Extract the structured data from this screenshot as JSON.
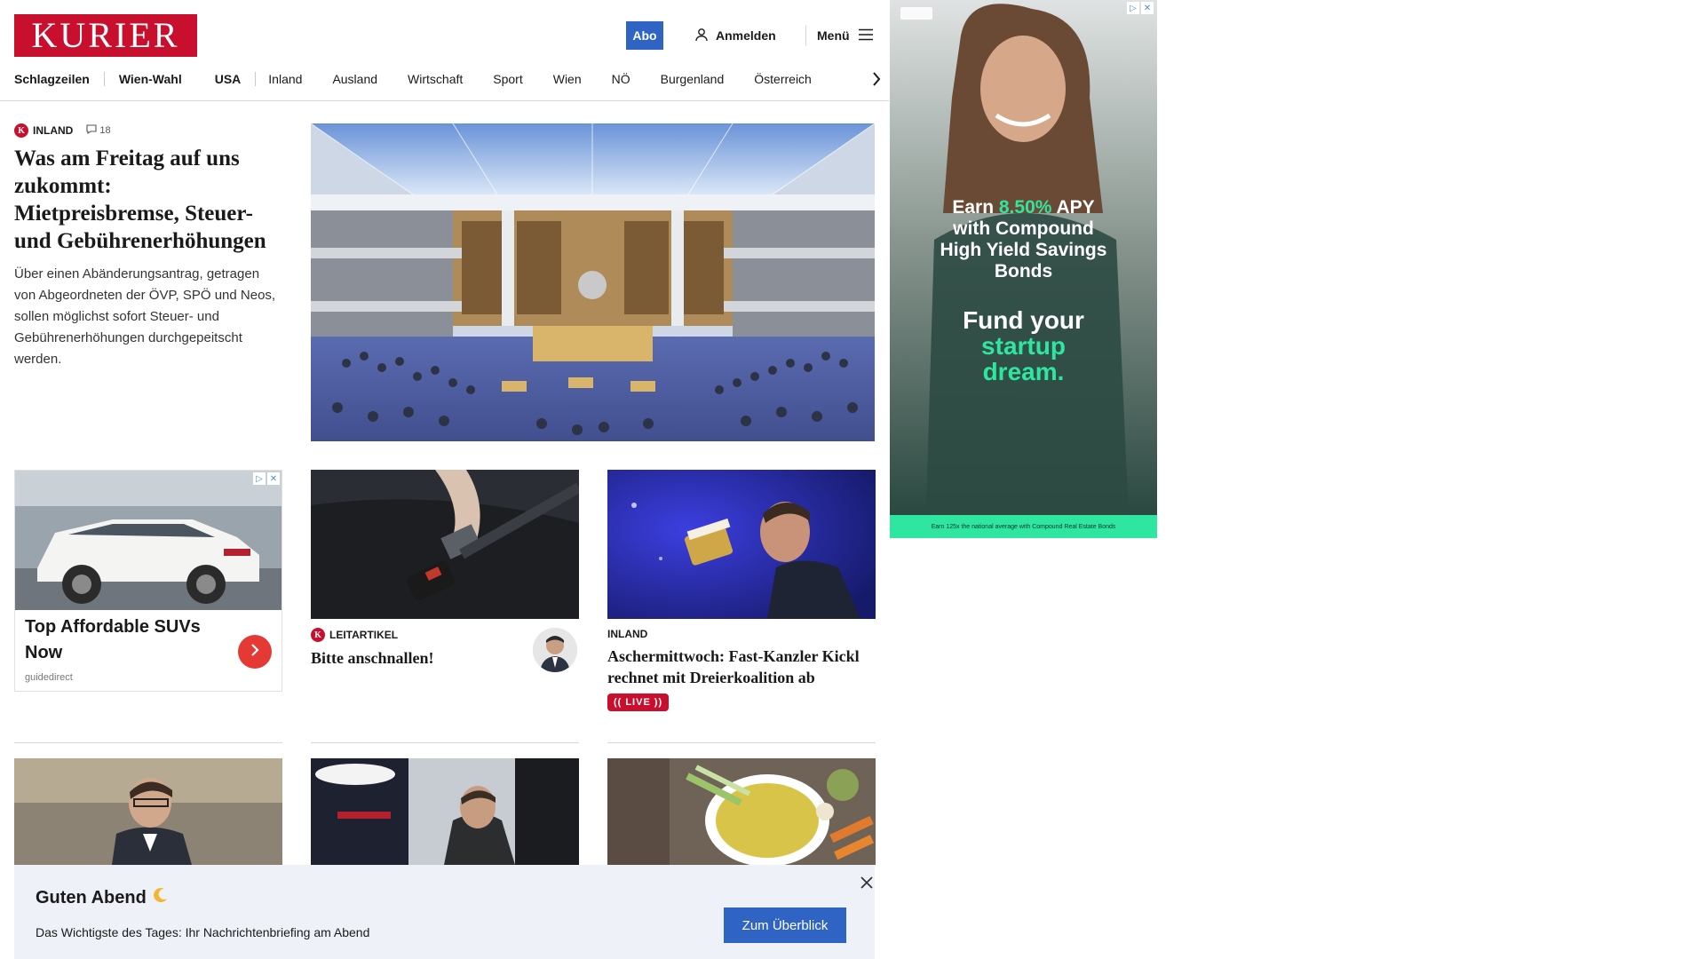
{
  "header": {
    "logo_text": "KURIER",
    "abo_label": "Abo",
    "login_label": "Anmelden",
    "menu_label": "Menü"
  },
  "nav": {
    "items": [
      "Schlagzeilen",
      "Wien-Wahl",
      "USA",
      "Inland",
      "Ausland",
      "Wirtschaft",
      "Sport",
      "Wien",
      "NÖ",
      "Burgenland",
      "Österreich"
    ]
  },
  "lead": {
    "badge": "K",
    "category": "INLAND",
    "comments": "18",
    "headline": "Was am Freitag auf uns zukommt: Mietpreisbremse, Steuer- und Gebührenerhöhungen",
    "teaser": "Über einen Abänderungsantrag, getragen von Abgeordneten der ÖVP, SPÖ und Neos, sollen möglichst sofort Steuer- und Gebührenerhöhungen durchgepeitscht werden."
  },
  "ad_card": {
    "title": "Top Affordable SUVs Now",
    "source": "guidedirect"
  },
  "card_leitartikel": {
    "badge": "K",
    "category": "LEITARTIKEL",
    "headline": "Bitte anschnallen!"
  },
  "card_inland": {
    "category": "INLAND",
    "headline": "Aschermittwoch: Fast-Kanzler Kickl rechnet mit Dreierkoalition ab",
    "live_label": "LIVE"
  },
  "briefing": {
    "title": "Guten Abend",
    "emoji": "🌙",
    "text": "Das Wichtigste des Tages: Ihr Nachrichtenbriefing am Abend",
    "button": "Zum Überblick"
  },
  "side_ad": {
    "line1_a": "Earn ",
    "line1_rate": "8.50%",
    "line1_b": " APY",
    "line2": "with Compound",
    "line3": "High Yield Savings",
    "line4": "Bonds",
    "cta1": "Fund your",
    "cta2": "startup",
    "cta3": "dream.",
    "footer": "Earn 125x the national average with Compound Real Estate Bonds"
  },
  "colors": {
    "brand_red": "#c8102e",
    "button_blue": "#2f63c4",
    "ad_green": "#2fe6a0"
  }
}
